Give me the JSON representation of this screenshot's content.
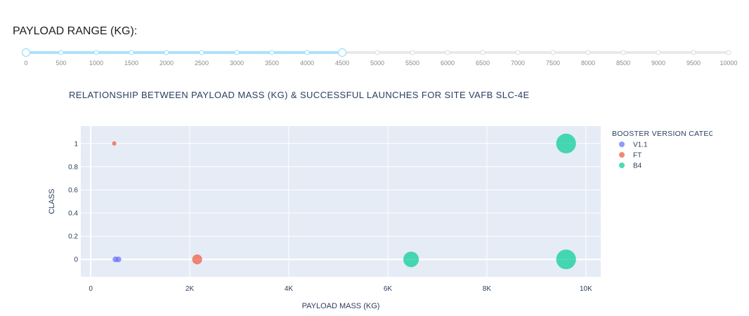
{
  "slider": {
    "title": "PAYLOAD RANGE (KG):",
    "min": 0,
    "max": 10000,
    "step": 500,
    "selected_range": [
      0,
      4500
    ],
    "marks": [
      "0",
      "500",
      "1000",
      "1500",
      "2000",
      "2500",
      "3000",
      "3500",
      "4000",
      "4500",
      "5000",
      "5500",
      "6000",
      "6500",
      "7000",
      "7500",
      "8000",
      "8500",
      "9000",
      "9500",
      "10000"
    ],
    "track_color": "#e9e9e9",
    "active_color": "#abe2fb",
    "handle_color": "#abe2fb"
  },
  "chart_data": {
    "type": "scatter",
    "title": "RELATIONSHIP BETWEEN PAYLOAD MASS (KG) & SUCCESSFUL LAUNCHES FOR SITE VAFB SLC-4E",
    "xlabel": "PAYLOAD MASS (KG)",
    "ylabel": "CLASS",
    "xlim": [
      -200,
      10300
    ],
    "ylim": [
      -0.15,
      1.15
    ],
    "xticks": [
      0,
      2000,
      4000,
      6000,
      8000,
      10000
    ],
    "xtick_labels": [
      "0",
      "2K",
      "4K",
      "6K",
      "8K",
      "10K"
    ],
    "yticks": [
      0,
      0.2,
      0.4,
      0.6,
      0.8,
      1
    ],
    "ytick_labels": [
      "0",
      "0.2",
      "0.4",
      "0.6",
      "0.8",
      "1"
    ],
    "grid": true,
    "legend_title": "BOOSTER VERSION CATEG",
    "legend_position": "right",
    "plot_bg": "#e5ecf6",
    "series": [
      {
        "name": "V1.1",
        "color": "#636efa",
        "points": [
          {
            "x": 500,
            "y": 0,
            "size": 4
          },
          {
            "x": 560,
            "y": 0,
            "size": 4
          }
        ]
      },
      {
        "name": "FT",
        "color": "#ef553b",
        "points": [
          {
            "x": 475,
            "y": 1,
            "size": 3
          },
          {
            "x": 2150,
            "y": 0,
            "size": 7
          }
        ]
      },
      {
        "name": "B4",
        "color": "#00cc96",
        "points": [
          {
            "x": 6470,
            "y": 0,
            "size": 11
          },
          {
            "x": 9600,
            "y": 0,
            "size": 14
          },
          {
            "x": 9600,
            "y": 1,
            "size": 14
          }
        ]
      }
    ]
  }
}
